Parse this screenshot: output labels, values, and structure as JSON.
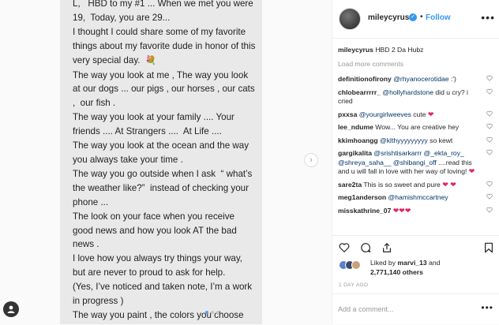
{
  "post_text": {
    "lines": [
      "L,   HBD to my #1 ... When we met you were 19,  Today, you are 29...",
      "I thought I could share some of my favorite things about my favorite dude in honor of this very special day.  ",
      "The way you look at me , The way you look at our dogs ... our pigs , our horses , our cats ,  our fish .",
      "The way you look at your family .... Your friends .... At Strangers ....  At Life ....",
      "The way you look at the ocean and the way you always take your time .",
      "The way you go outside when I ask  “ what’s the weather like?”  instead of checking your phone ...",
      "The look on your face when you receive good news and how you look AT the bad news .",
      "I love how you always try things your way, but are never to proud to ask for help.",
      "(Yes, I’ve noticed and taken note, I’m a work in progress )",
      "The way you paint , the colors you choose   ...."
    ],
    "flower_emoji": "💐"
  },
  "header": {
    "username": "mileycyrus",
    "separator": "•",
    "follow_label": "Follow",
    "more_icon": "more-horizontal-icon"
  },
  "caption": {
    "username": "mileycyrus",
    "text": "HBD 2 Da Hubz"
  },
  "load_more_label": "Load more comments",
  "comments": [
    {
      "user": "definitionofirony",
      "mention": "@rhyanocerotidae",
      "text": " :')"
    },
    {
      "user": "chlobearrrrr_",
      "mention": "@hollyhardstone",
      "text": " did u cry? i cried"
    },
    {
      "user": "pxxsa",
      "mention": "@yourgirlweeves",
      "text": " cute",
      "emoji": "❤"
    },
    {
      "user": "lee_ndume",
      "mention": "",
      "text": "Wow... You are creative hey"
    },
    {
      "user": "kkimhoangg",
      "mention": "@klthyyyyyyyyy",
      "text": " so kewt"
    },
    {
      "user": "gargikalita",
      "mention": "@srishtisarkarrr @_ekta_roy_ @shreya_saha__ @shibangi_off",
      "text": " ....read this and u will fall in love with her way of loving!",
      "emoji": "❤"
    },
    {
      "user": "sare2ta",
      "mention": "",
      "text": "This is so sweet and pure ",
      "emoji": "❤ ❤"
    },
    {
      "user": "meg1anderson",
      "mention": "@hamishmccartney",
      "text": ""
    },
    {
      "user": "misskathrine_07",
      "mention": "",
      "text": "",
      "emoji": "❤❤❤"
    }
  ],
  "likes": {
    "text_prefix": "Liked by",
    "liker": "marvi_13",
    "text_mid": "and",
    "count": "2,771,140",
    "text_suffix": "others"
  },
  "timestamp": "1 DAY AGO",
  "add_comment_placeholder": "Add a comment...",
  "colors": {
    "link": "#003569",
    "follow": "#3897f0",
    "heart": "#e0245e",
    "muted": "#999999"
  }
}
